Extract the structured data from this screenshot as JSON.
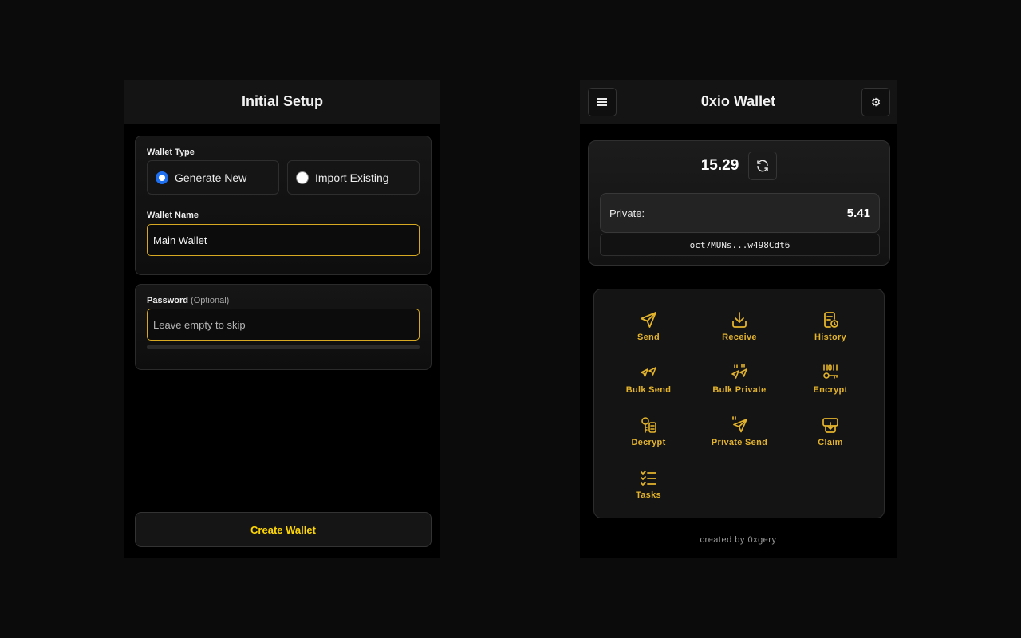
{
  "setup": {
    "title": "Initial Setup",
    "wallet_type_label": "Wallet Type",
    "options": [
      {
        "label": "Generate New",
        "selected": true
      },
      {
        "label": "Import Existing",
        "selected": false
      }
    ],
    "wallet_name_label": "Wallet Name",
    "wallet_name_value": "Main Wallet",
    "password_label": "Password",
    "password_optional": "(Optional)",
    "password_placeholder": "Leave empty to skip",
    "create_button": "Create Wallet"
  },
  "wallet": {
    "title": "0xio Wallet",
    "menu_icon": "menu-icon",
    "settings_icon": "gear-icon",
    "balance": "15.29",
    "refresh_icon": "refresh-icon",
    "private_label": "Private:",
    "private_value": "5.41",
    "address": "oct7MUNs...w498Cdt6",
    "actions": [
      {
        "label": "Send",
        "icon": "send-icon"
      },
      {
        "label": "Receive",
        "icon": "receive-icon"
      },
      {
        "label": "History",
        "icon": "history-icon"
      },
      {
        "label": "Bulk Send",
        "icon": "bulk-send-icon"
      },
      {
        "label": "Bulk Private",
        "icon": "bulk-private-icon"
      },
      {
        "label": "Encrypt",
        "icon": "encrypt-icon"
      },
      {
        "label": "Decrypt",
        "icon": "decrypt-icon"
      },
      {
        "label": "Private Send",
        "icon": "private-send-icon"
      },
      {
        "label": "Claim",
        "icon": "claim-icon"
      },
      {
        "label": "Tasks",
        "icon": "tasks-icon"
      }
    ],
    "footer": "created by 0xgery"
  },
  "colors": {
    "accent_gold": "#e3b32c",
    "button_yellow": "#ffd700",
    "input_border": "#d7a922",
    "radio_blue": "#1e6ff0",
    "background": "#0b0b0b"
  }
}
